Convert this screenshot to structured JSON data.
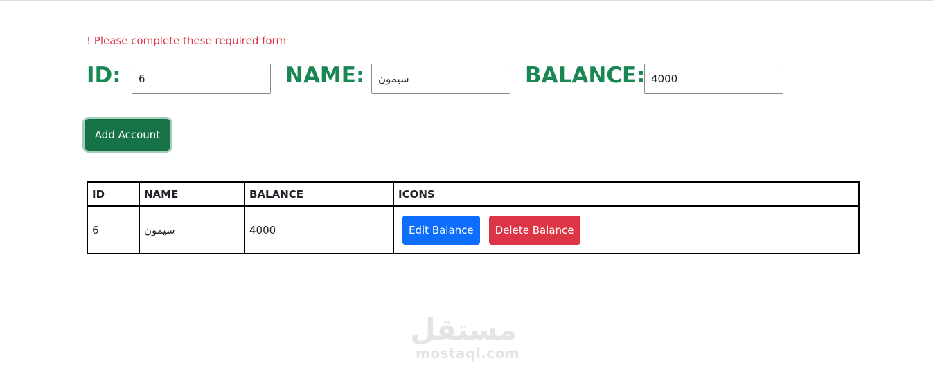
{
  "form": {
    "error_message": "! Please complete these required form",
    "id_label": "ID:",
    "id_value": "6",
    "name_label": "NAME:",
    "name_value": "سيمون",
    "balance_label": "BALANCE:",
    "balance_value": "4000",
    "add_button_label": "Add Account"
  },
  "table": {
    "headers": [
      "ID",
      "NAME",
      "BALANCE",
      "ICONS"
    ],
    "rows": [
      {
        "id": "6",
        "name": "سيمون",
        "balance": "4000",
        "edit_label": "Edit Balance",
        "delete_label": "Delete Balance"
      }
    ]
  },
  "watermark": {
    "arabic": "مستقل",
    "latin": "mostaql.com"
  },
  "colors": {
    "label_green": "#198754",
    "add_button": "#157347",
    "edit_button": "#0d6efd",
    "delete_button": "#dc3545",
    "error_text": "#dc3545"
  }
}
